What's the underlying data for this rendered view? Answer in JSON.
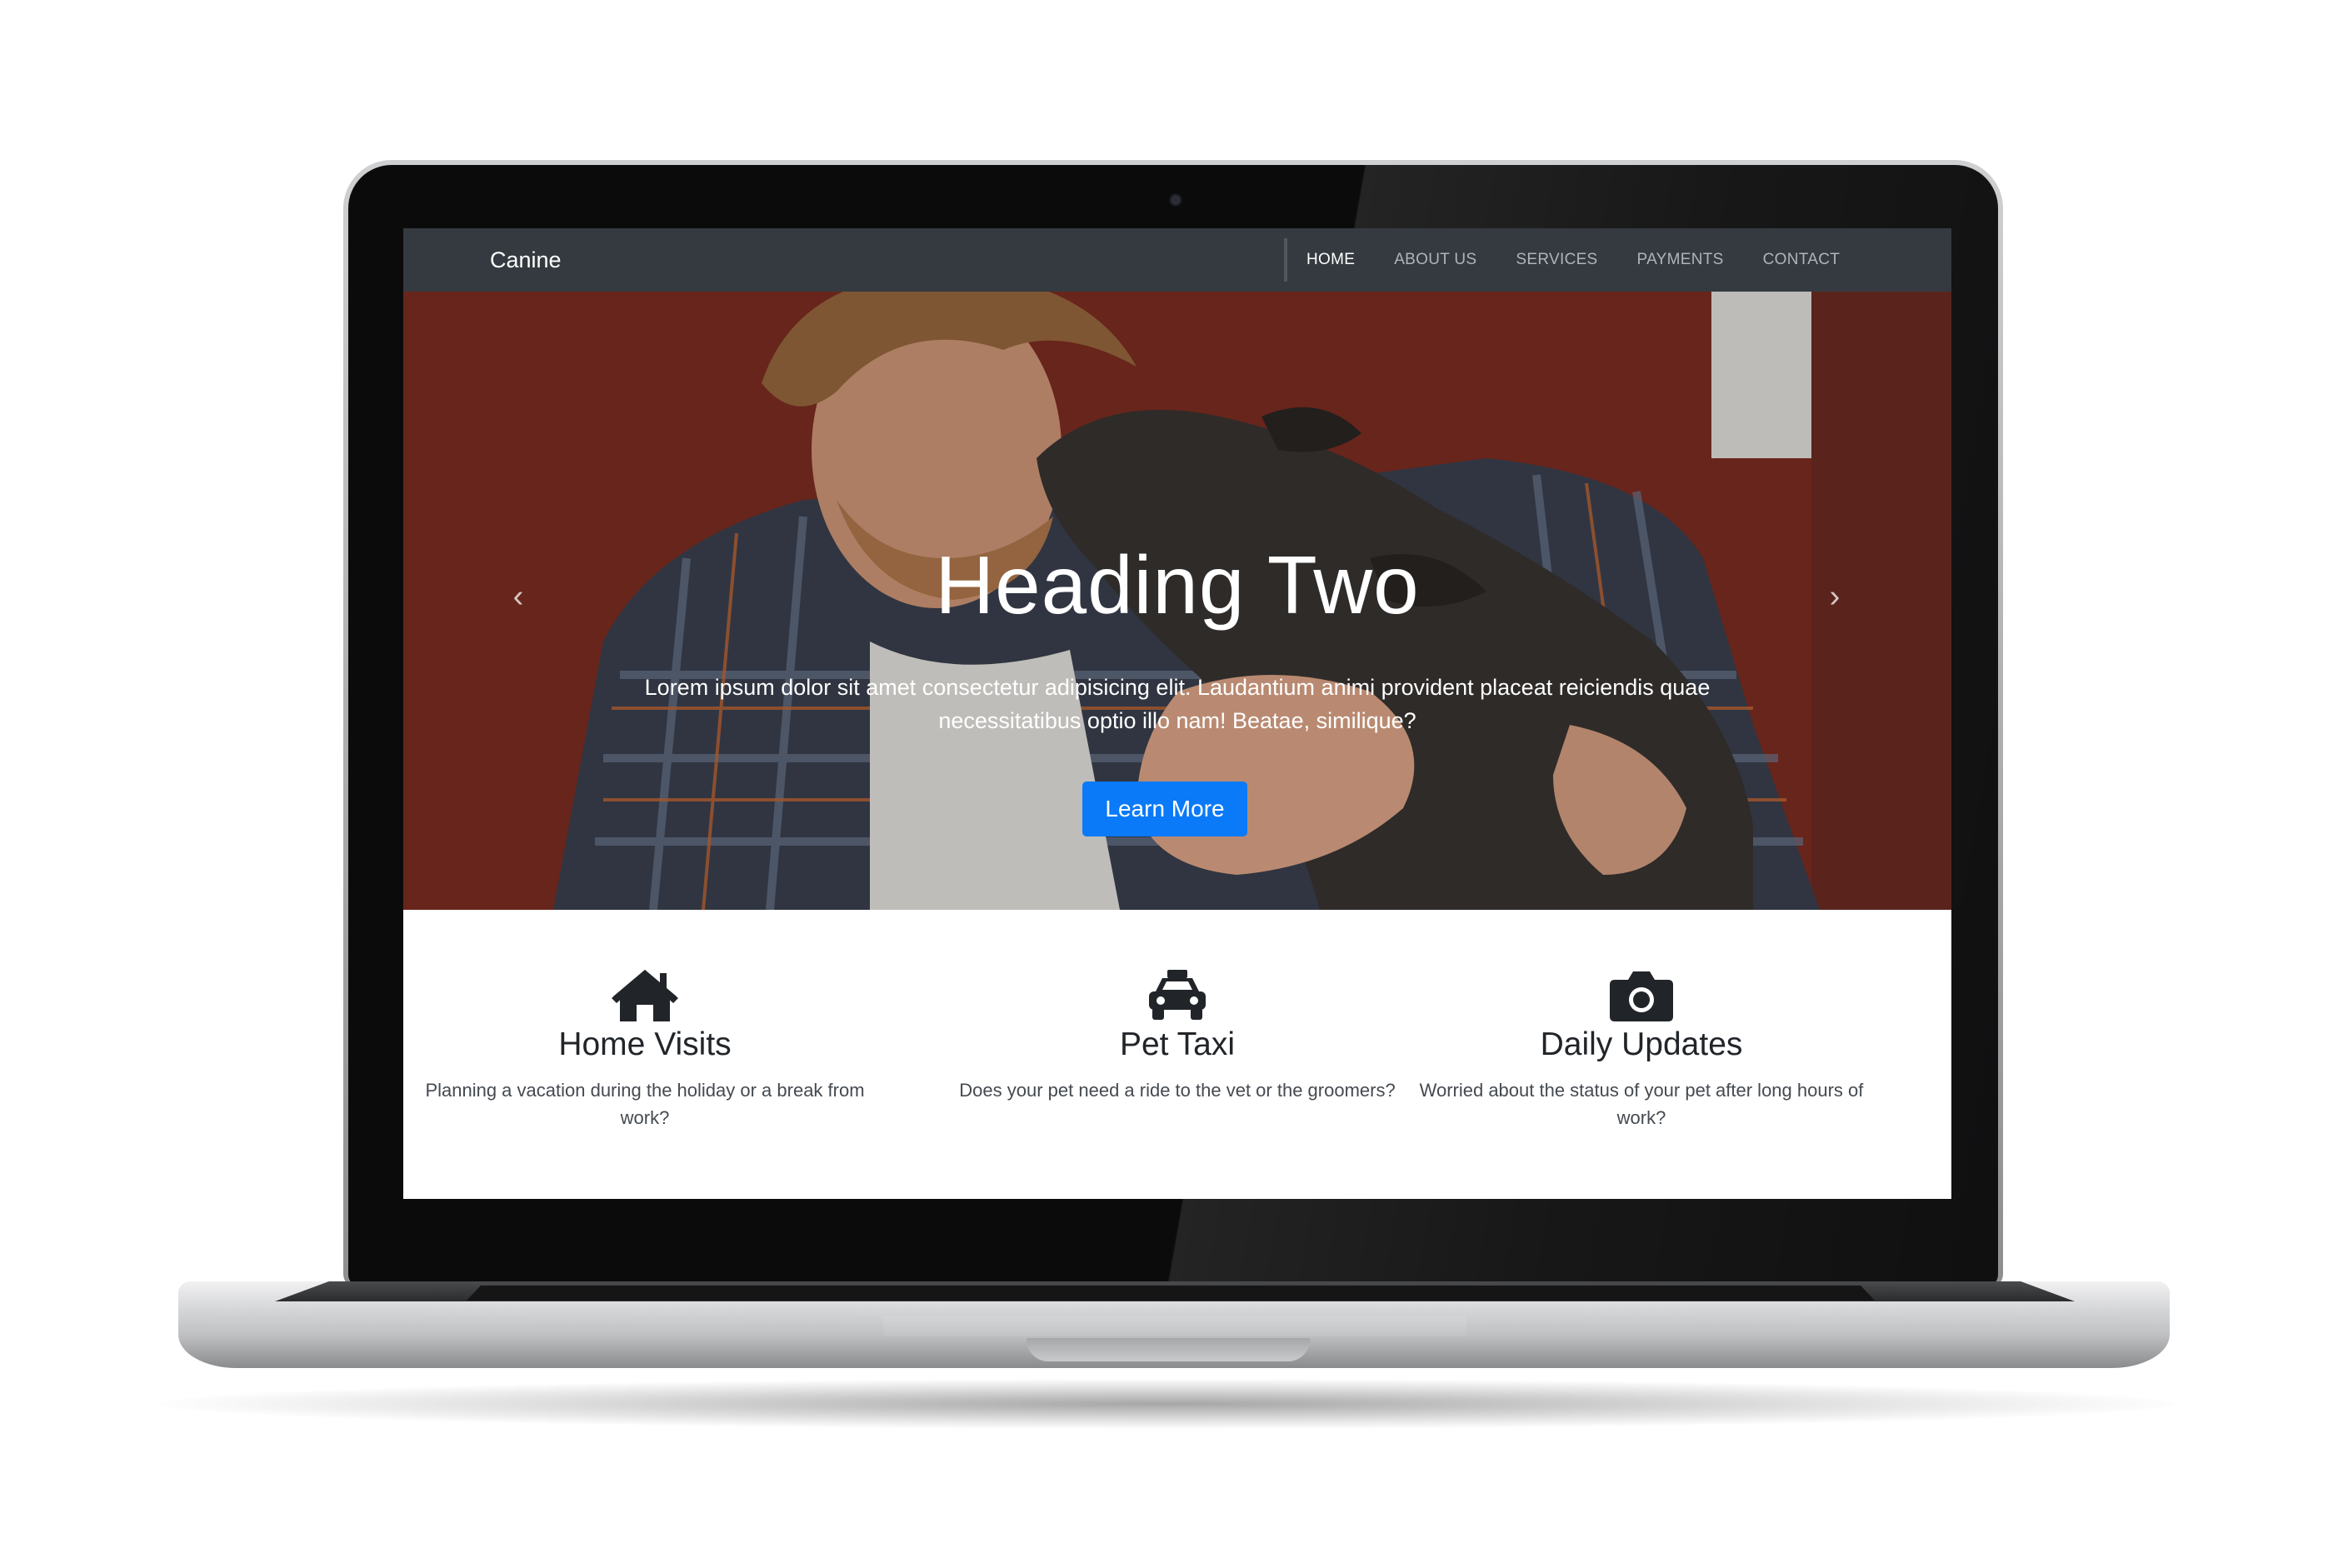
{
  "navbar": {
    "brand": "Canine",
    "links": [
      {
        "label": "HOME",
        "active": true
      },
      {
        "label": "ABOUT US",
        "active": false
      },
      {
        "label": "SERVICES",
        "active": false
      },
      {
        "label": "PAYMENTS",
        "active": false
      },
      {
        "label": "CONTACT",
        "active": false
      }
    ]
  },
  "hero": {
    "heading": "Heading Two",
    "text": "Lorem ipsum dolor sit amet consectetur adipisicing elit. Laudantium animi provident placeat reiciendis quae necessitatibus optio illo nam! Beatae, similique?",
    "button": "Learn More",
    "prev_icon": "chevron-left-icon",
    "next_icon": "chevron-right-icon",
    "slide_count": 2,
    "active_slide": 1
  },
  "features": [
    {
      "icon": "home-icon",
      "title": "Home Visits",
      "description": "Planning a vacation during the holiday or a break from work?"
    },
    {
      "icon": "taxi-icon",
      "title": "Pet Taxi",
      "description": "Does your pet need a ride to the vet or the groomers?"
    },
    {
      "icon": "camera-icon",
      "title": "Daily Updates",
      "description": "Worried about the status of your pet after long hours of work?"
    }
  ],
  "colors": {
    "navbar_bg": "#343a40",
    "accent": "#0a7af8",
    "text_dark": "#212529"
  }
}
